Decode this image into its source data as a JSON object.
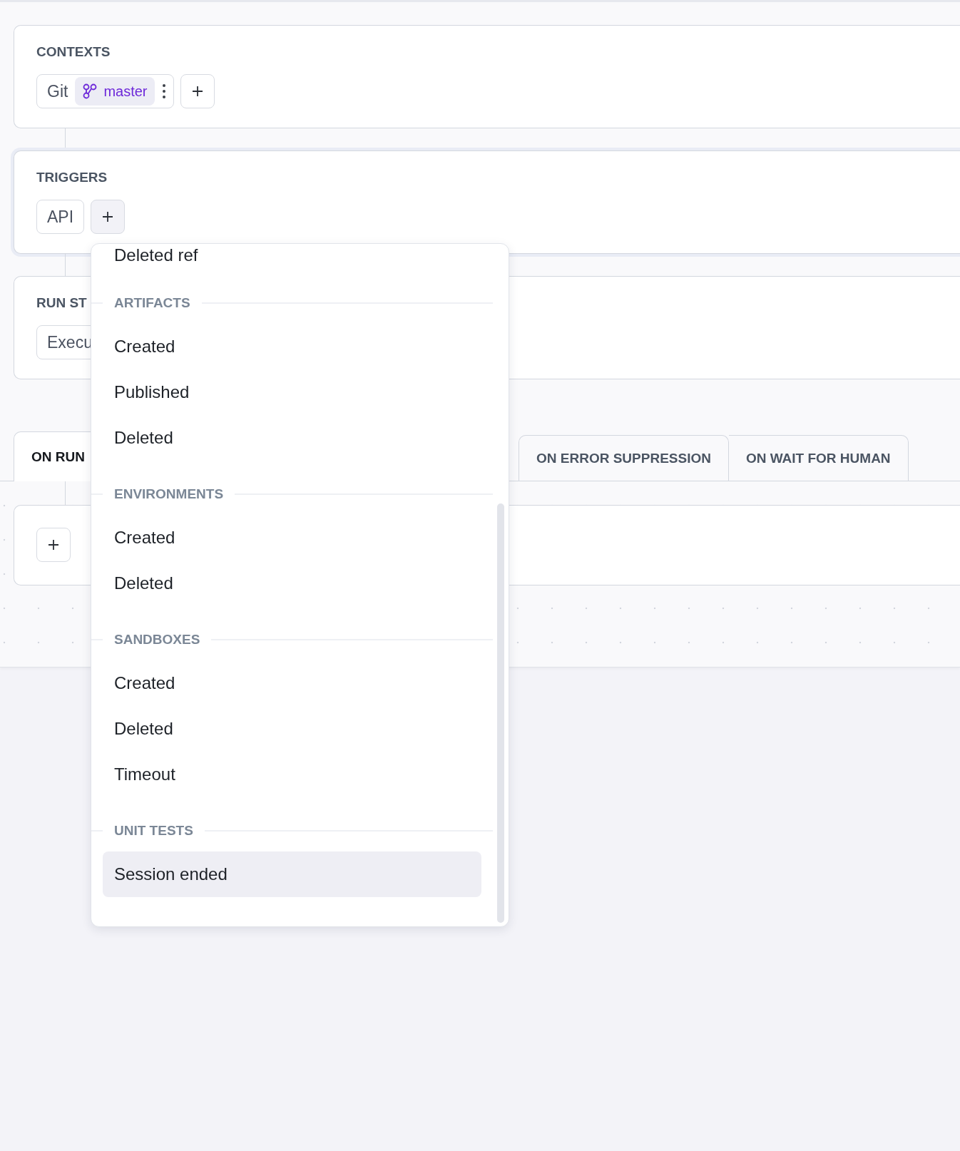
{
  "contexts": {
    "label": "CONTEXTS",
    "chips": [
      {
        "name": "Git",
        "branch": "master"
      }
    ]
  },
  "triggers": {
    "label": "TRIGGERS",
    "chips": [
      {
        "name": "API"
      }
    ]
  },
  "run_steps": {
    "label": "RUN ST",
    "chips": [
      {
        "name": "Execu"
      }
    ]
  },
  "tabs": [
    {
      "label": "ON RUN",
      "selected": true
    },
    {
      "label": "ON ERROR SUPPRESSION",
      "selected": false
    },
    {
      "label": "ON WAIT FOR HUMAN",
      "selected": false
    }
  ],
  "menu": {
    "groups": [
      {
        "items": [
          {
            "label": "Deleted ref",
            "highlighted": false
          }
        ]
      },
      {
        "header": "ARTIFACTS",
        "items": [
          {
            "label": "Created",
            "highlighted": false
          },
          {
            "label": "Published",
            "highlighted": false
          },
          {
            "label": "Deleted",
            "highlighted": false
          }
        ]
      },
      {
        "header": "ENVIRONMENTS",
        "items": [
          {
            "label": "Created",
            "highlighted": false
          },
          {
            "label": "Deleted",
            "highlighted": false
          }
        ]
      },
      {
        "header": "SANDBOXES",
        "items": [
          {
            "label": "Created",
            "highlighted": false
          },
          {
            "label": "Deleted",
            "highlighted": false
          },
          {
            "label": "Timeout",
            "highlighted": false
          }
        ]
      },
      {
        "header": "UNIT TESTS",
        "items": [
          {
            "label": "Session ended",
            "highlighted": true
          }
        ]
      }
    ]
  }
}
